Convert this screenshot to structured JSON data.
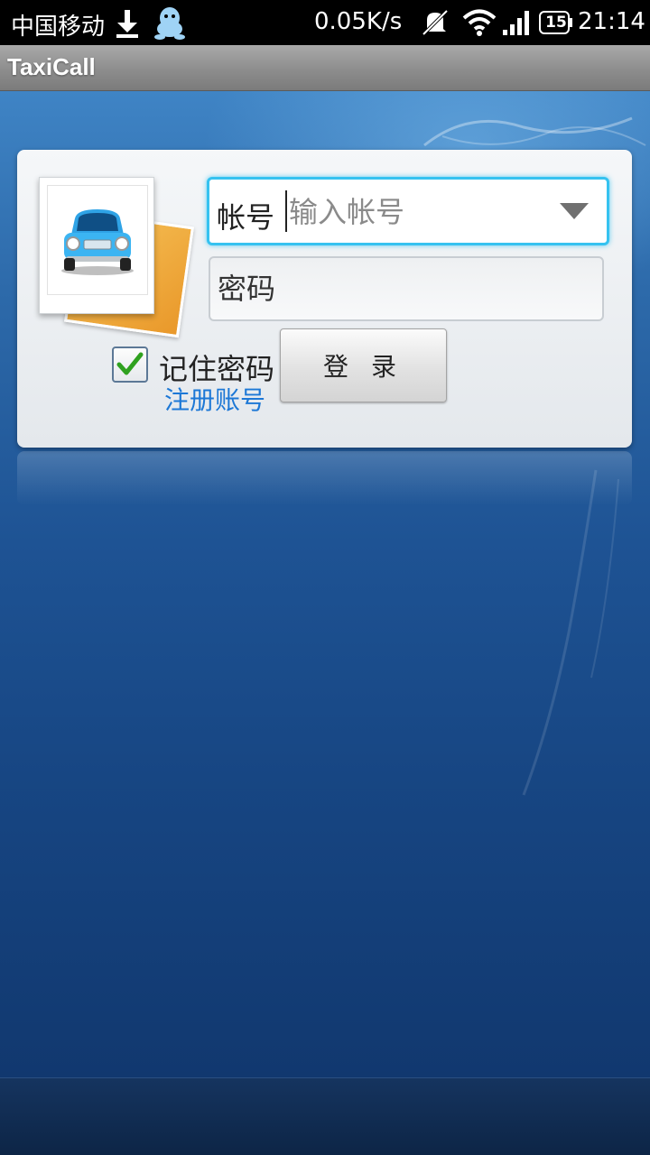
{
  "status_bar": {
    "carrier": "中国移动",
    "net_speed": "0.05K/s",
    "battery": "15",
    "time": "21:14",
    "icons": [
      "download-icon",
      "qq-icon",
      "mute-icon",
      "wifi-icon",
      "signal-icon",
      "battery-icon"
    ]
  },
  "app": {
    "title": "TaxiCall"
  },
  "login": {
    "account_label": "帐号",
    "account_placeholder": "输入帐号",
    "password_placeholder": "密码",
    "remember_label": "记住密码",
    "remember_checked": true,
    "register_link": "注册账号",
    "login_button": "登 录"
  },
  "colors": {
    "accent_focus": "#35c2f0",
    "link": "#1d78d6",
    "checkmark": "#2fa11f",
    "background_top": "#3f84c5",
    "background_bottom": "#11386f"
  }
}
